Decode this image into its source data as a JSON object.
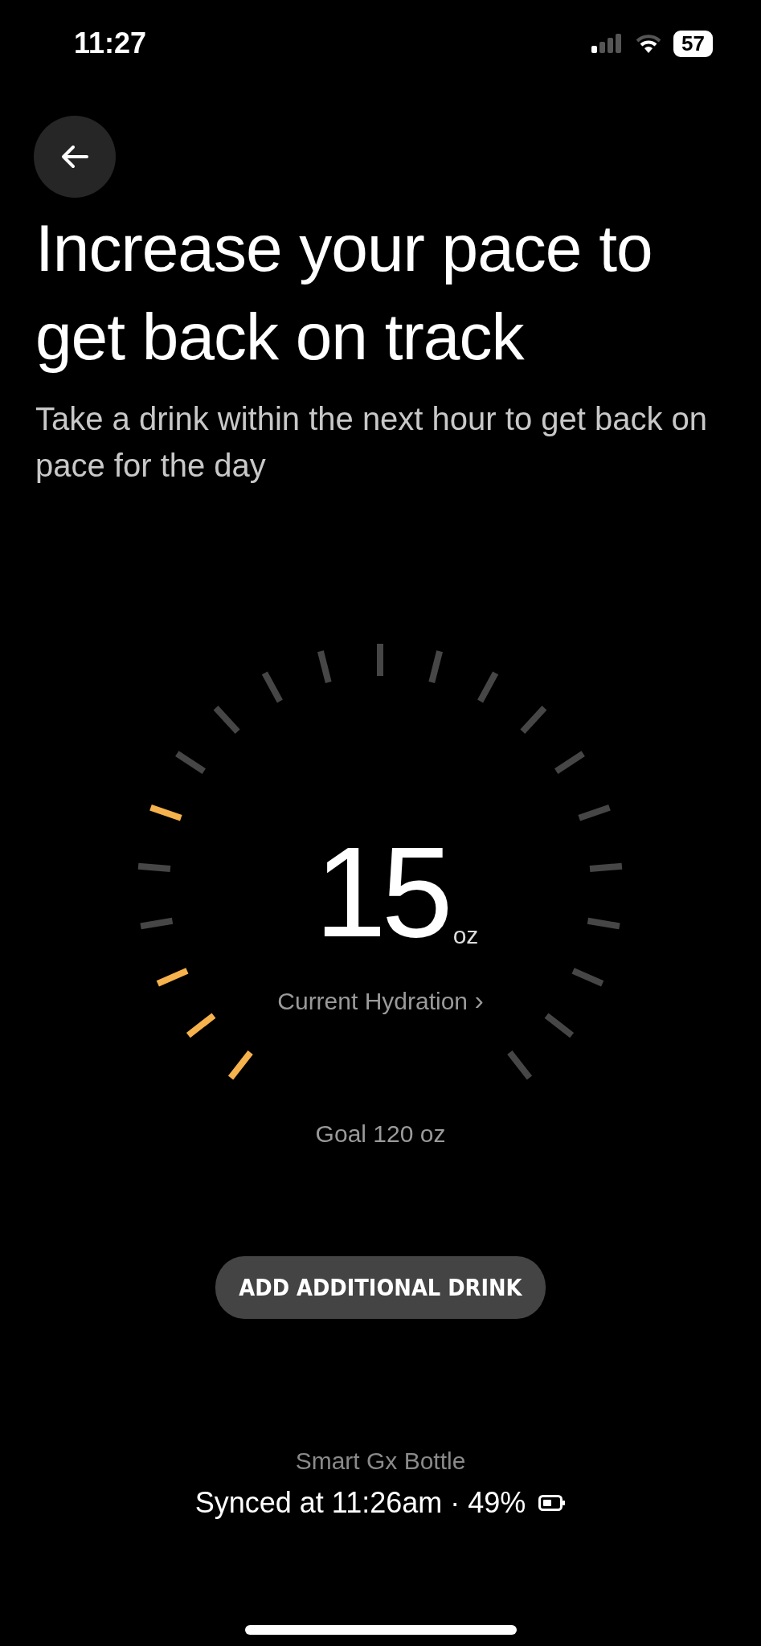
{
  "status_bar": {
    "time": "11:27",
    "battery": "57"
  },
  "header": {
    "title": "Increase your pace to get back on track",
    "subtitle": "Take a drink within the next hour to get back on pace for the day"
  },
  "gauge": {
    "value": "15",
    "unit": "oz",
    "link": "Current Hydration",
    "link_chevron": "›",
    "goal": "Goal 120 oz",
    "ticks": [
      {
        "color": "#f6b24c"
      },
      {
        "color": "#f6b24c"
      },
      {
        "color": "#f6b24c"
      },
      {
        "color": "#464646"
      },
      {
        "color": "#464646"
      },
      {
        "color": "#f6b24c"
      },
      {
        "color": "#464646"
      },
      {
        "color": "#464646"
      },
      {
        "color": "#464646"
      },
      {
        "color": "#464646"
      },
      {
        "color": "#464646"
      },
      {
        "color": "#464646"
      },
      {
        "color": "#464646"
      },
      {
        "color": "#464646"
      },
      {
        "color": "#464646"
      },
      {
        "color": "#464646"
      },
      {
        "color": "#464646"
      },
      {
        "color": "#464646"
      },
      {
        "color": "#464646"
      },
      {
        "color": "#464646"
      },
      {
        "color": "#464646"
      }
    ]
  },
  "add_button": "ADD ADDITIONAL DRINK",
  "device": {
    "name": "Smart Gx Bottle",
    "sync": "Synced at 11:26am · 49%"
  }
}
